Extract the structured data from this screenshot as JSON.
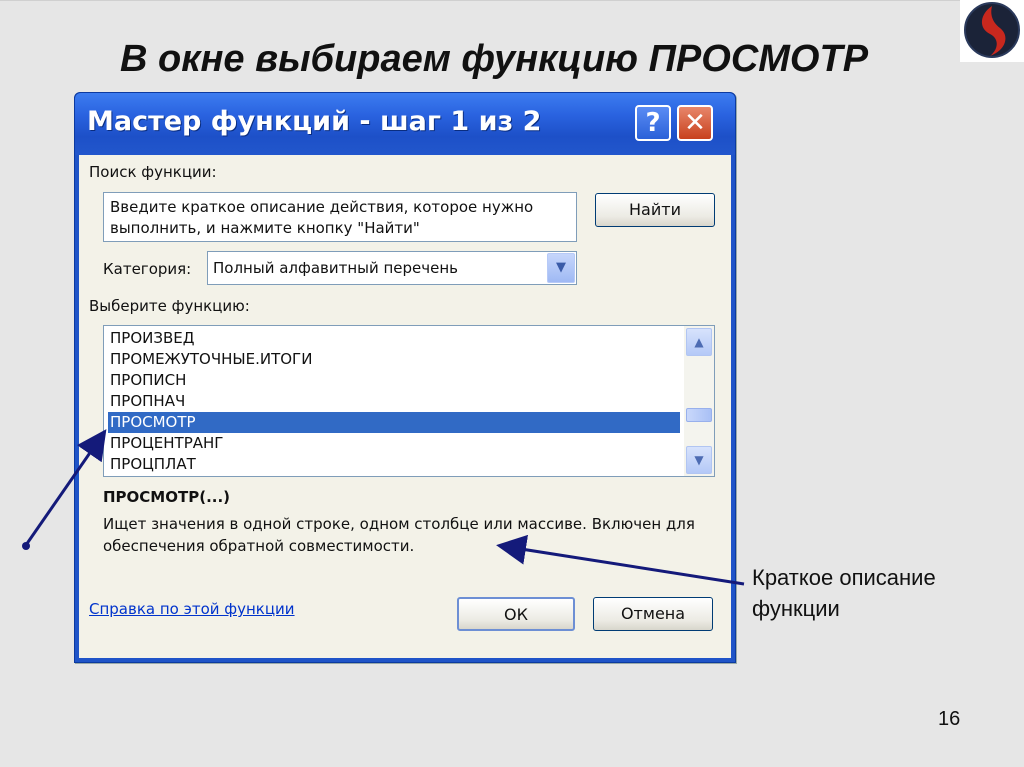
{
  "slide": {
    "title": "В окне выбираем функцию ПРОСМОТР",
    "page_number": "16",
    "callout": "Краткое описание функции"
  },
  "dialog": {
    "title": "Мастер функций - шаг 1 из 2",
    "help_button": "?",
    "close_button": "✕",
    "search_label": "Поиск функции:",
    "search_text": "Введите краткое описание действия, которое нужно выполнить, и нажмите кнопку \"Найти\"",
    "find_button": "Найти",
    "category_label": "Категория:",
    "category_value": "Полный алфавитный перечень",
    "choose_label": "Выберите функцию:",
    "functions": [
      "ПРОИЗВЕД",
      "ПРОМЕЖУТОЧНЫЕ.ИТОГИ",
      "ПРОПИСН",
      "ПРОПНАЧ",
      "ПРОСМОТР",
      "ПРОЦЕНТРАНГ",
      "ПРОЦПЛАТ"
    ],
    "selected_function": "ПРОСМОТР",
    "signature": "ПРОСМОТР(...)",
    "description": "Ищет значения в одной строке, одном столбце или массиве. Включен для обеспечения обратной совместимости.",
    "help_link": "Справка по этой функции",
    "ok_button": "ОК",
    "cancel_button": "Отмена"
  },
  "colors": {
    "titlebar": "#2a63e0",
    "selection": "#316ac5",
    "arrow": "#141a7a"
  }
}
